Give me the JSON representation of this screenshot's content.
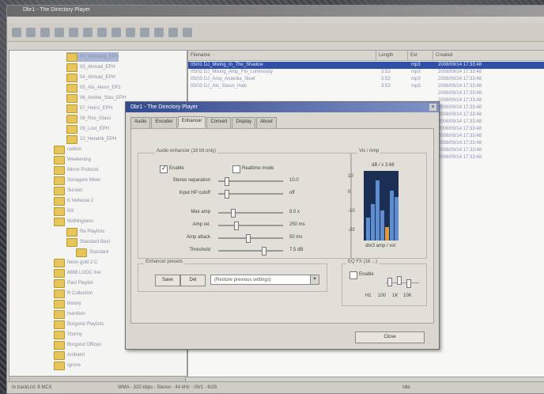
{
  "status": {
    "left": "In trackList: 8 MCX",
    "middle": "WMA - 320 kbps - Stereo - 44 kHz - 00/1 - 6/29",
    "right": "Idle"
  },
  "list": {
    "columns": [
      "Filename",
      "Length",
      "Ext",
      "Created"
    ],
    "rows": [
      {
        "name": "05/01 DJ_Mixing_In_The_Shadow",
        "length": "",
        "ext": "mp3",
        "created": "2008/09/14 17:33:48"
      },
      {
        "name": "05/02 DJ_Mixing_Amp_Fin_Luminosity",
        "length": "3:53",
        "ext": "mp3",
        "created": "2008/09/14 17:33:48"
      },
      {
        "name": "05/03 DJ_Amp_Anatolia_Sleet",
        "length": "3:53",
        "ext": "mp3",
        "created": "2008/09/14 17:33:48"
      },
      {
        "name": "05/03 DJ_Ats_Stasis_Halo",
        "length": "3:53",
        "ext": "mp3",
        "created": "2008/09/14 17:33:48"
      },
      {
        "name": "",
        "length": "",
        "ext": "",
        "created": "2008/09/14 17:33:48"
      },
      {
        "name": "",
        "length": "",
        "ext": "",
        "created": "2008/09/14 17:33:48"
      },
      {
        "name": "",
        "length": "",
        "ext": "",
        "created": "2008/09/14 17:33:48"
      },
      {
        "name": "",
        "length": "",
        "ext": "",
        "created": "2008/09/14 17:33:48"
      },
      {
        "name": "",
        "length": "",
        "ext": "",
        "created": "2008/09/14 17:33:48"
      },
      {
        "name": "",
        "length": "",
        "ext": "",
        "created": "2008/09/14 17:33:48"
      },
      {
        "name": "",
        "length": "",
        "ext": "",
        "created": "2008/09/14 17:33:48"
      },
      {
        "name": "",
        "length": "",
        "ext": "",
        "created": "2008/09/14 17:33:48"
      },
      {
        "name": "",
        "length": "",
        "ext": "",
        "created": "2008/09/14 17:33:48"
      },
      {
        "name": "",
        "length": "",
        "ext": "",
        "created": "2008/09/14 17:33:48"
      }
    ]
  },
  "tree": {
    "items": [
      {
        "label": "03_Weirding_EPH",
        "selected": true
      },
      {
        "label": "03_Ahmad_EPH"
      },
      {
        "label": "04_Ahmad_EPH"
      },
      {
        "label": "05_Ats_Alexo_EP1"
      },
      {
        "label": "06_Andrei_Stas_EPH"
      },
      {
        "label": "07_Heinz_EPH"
      },
      {
        "label": "08_Ros_Glass"
      },
      {
        "label": "09_Lost_EPH"
      },
      {
        "label": "10_Hendrik_EPH"
      },
      {
        "label": "radioio"
      },
      {
        "label": "Weekening"
      },
      {
        "label": "Mirror Protocol"
      },
      {
        "label": "Sonagere Mixer"
      },
      {
        "label": "Sunnet"
      },
      {
        "label": "K Velleuse 2"
      },
      {
        "label": "Kill"
      },
      {
        "label": "Nothingness"
      },
      {
        "label": "Re Playlists"
      },
      {
        "label": "Standard Best"
      },
      {
        "label": "Standard"
      },
      {
        "label": "Neon gold 2 C"
      },
      {
        "label": "8888 LOOC live"
      },
      {
        "label": "Past Playlist"
      },
      {
        "label": "R Collection"
      },
      {
        "label": "history"
      },
      {
        "label": "Inanition"
      },
      {
        "label": "Burgund Playlists"
      },
      {
        "label": "Stormy"
      },
      {
        "label": "Burgund Offices"
      },
      {
        "label": "Ambient"
      },
      {
        "label": "Ignore"
      }
    ]
  },
  "dialog": {
    "title": "Dbr1 - The Directory Player",
    "close": "×",
    "tabs": [
      "Audio",
      "Encoder",
      "Enhancer",
      "Convert",
      "Display",
      "About"
    ],
    "active_tab": "Enhancer",
    "enhancer_group_label": "Audio enhancer (16 bit only)",
    "enable_label": "Enable",
    "enable_checked": true,
    "realtime_label": "Realtime mode",
    "sliders": [
      {
        "label": "Stereo separation",
        "value": "10.0"
      },
      {
        "label": "Input HP cutoff",
        "value": "off"
      },
      {
        "label": "Max amp",
        "value": "8.0 x"
      },
      {
        "label": "Amp rel.",
        "value": "250 ms"
      },
      {
        "label": "Amp attack",
        "value": "50 ms"
      },
      {
        "label": "Threshold",
        "value": "7.5 dB"
      }
    ],
    "visual_label": "Vis / Amp",
    "visual_top": "dB / x 3.66",
    "visual_bottom": "dbr3 amp / vol",
    "visual_scale": [
      "10",
      "0",
      "-10",
      "-20"
    ],
    "vis_bars": [
      0.35,
      0.55,
      0.9,
      0.45,
      0.2,
      0.75,
      0.65
    ],
    "presets_label": "Enhancer presets",
    "preset_buttons": [
      "Save",
      "Del"
    ],
    "preset_value": "(Restore previous settings)",
    "eq_label": "EQ FX (16 ...)",
    "eq_enable": "Enable",
    "eq_ticks": [
      "Hz",
      "100",
      "1K",
      "10K"
    ],
    "close_button": "Close"
  }
}
